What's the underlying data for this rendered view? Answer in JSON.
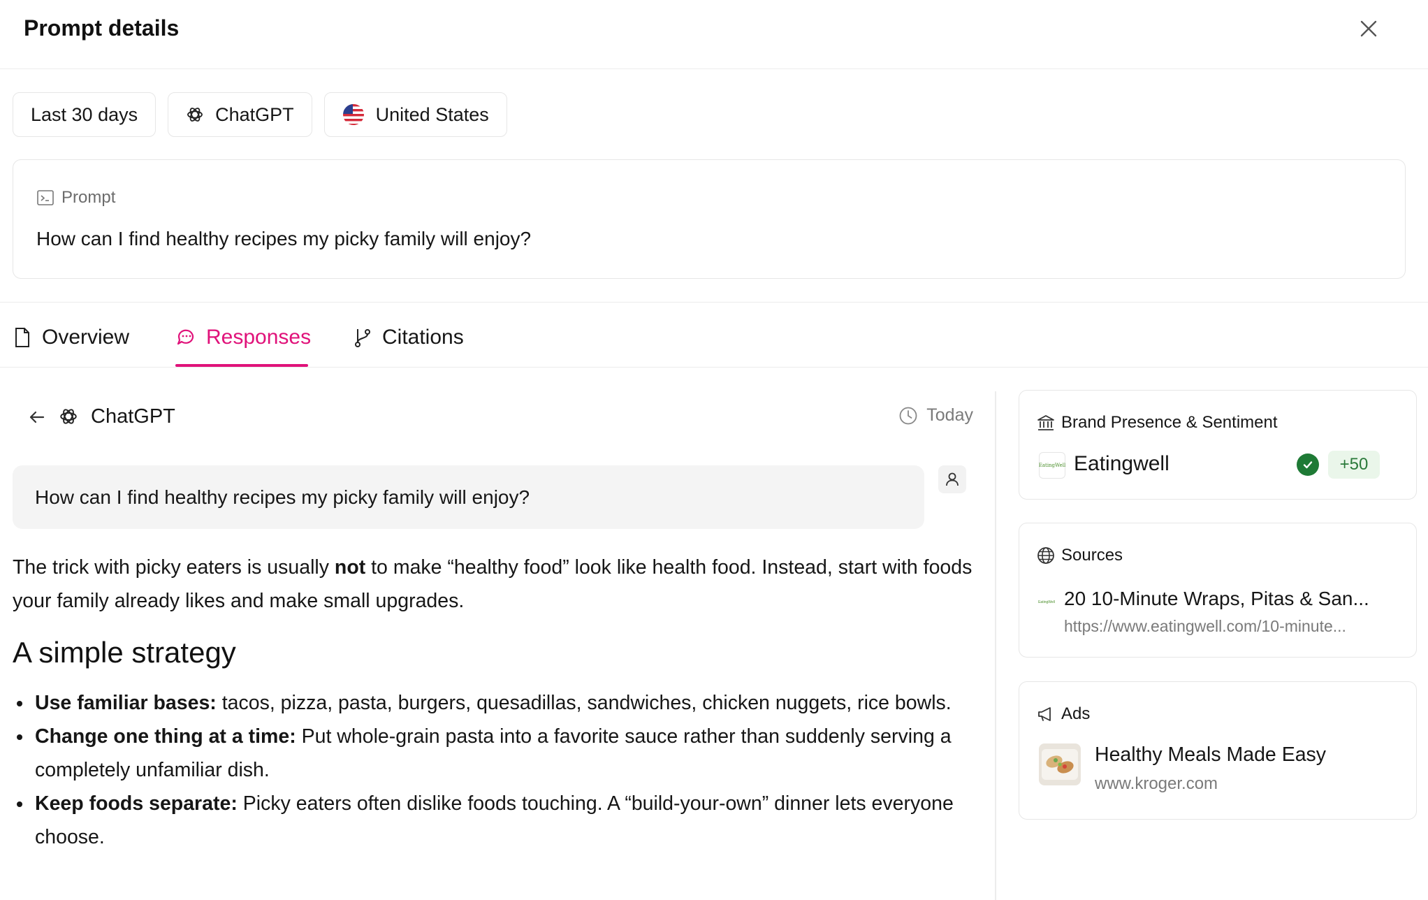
{
  "header": {
    "title": "Prompt details"
  },
  "filters": {
    "date_range": "Last 30 days",
    "model": "ChatGPT",
    "country": "United States"
  },
  "prompt": {
    "label": "Prompt",
    "text": "How can I find healthy recipes my picky family will enjoy?"
  },
  "tabs": [
    {
      "label": "Overview",
      "icon": "document-icon",
      "active": false
    },
    {
      "label": "Responses",
      "icon": "chat-bubbles-icon",
      "active": true
    },
    {
      "label": "Citations",
      "icon": "git-branch-icon",
      "active": false
    }
  ],
  "response": {
    "model": "ChatGPT",
    "date": "Today",
    "user_message": "How can I find healthy recipes my picky family will enjoy?",
    "intro_before": "The trick with picky eaters is usually ",
    "intro_bold": "not",
    "intro_after": " to make “healthy food” look like health food. Instead, start with foods your family already likes and make small upgrades.",
    "heading": "A simple strategy",
    "bullets": [
      {
        "bold": "Use familiar bases:",
        "text": " tacos, pizza, pasta, burgers, quesadillas, sandwiches, chicken nuggets, rice bowls."
      },
      {
        "bold": "Change one thing at a time:",
        "text": " Put whole-grain pasta into a favorite sauce rather than suddenly serving a completely unfamiliar dish."
      },
      {
        "bold": "Keep foods separate:",
        "text": " Picky eaters often dislike foods touching. A “build-your-own” dinner lets everyone choose."
      }
    ]
  },
  "brand_card": {
    "title": "Brand Presence & Sentiment",
    "brand": "Eatingwell",
    "logo_text": "EatingWell",
    "score": "+50",
    "status_color": "#1e7a35"
  },
  "sources_card": {
    "title": "Sources",
    "logo_text": "EatingWell",
    "item_title": "20 10-Minute Wraps, Pitas & San...",
    "item_url": "https://www.eatingwell.com/10-minute..."
  },
  "ads_card": {
    "title": "Ads",
    "item_title": "Healthy Meals Made Easy",
    "item_url": "www.kroger.com"
  },
  "accent_color": "#e0127a"
}
